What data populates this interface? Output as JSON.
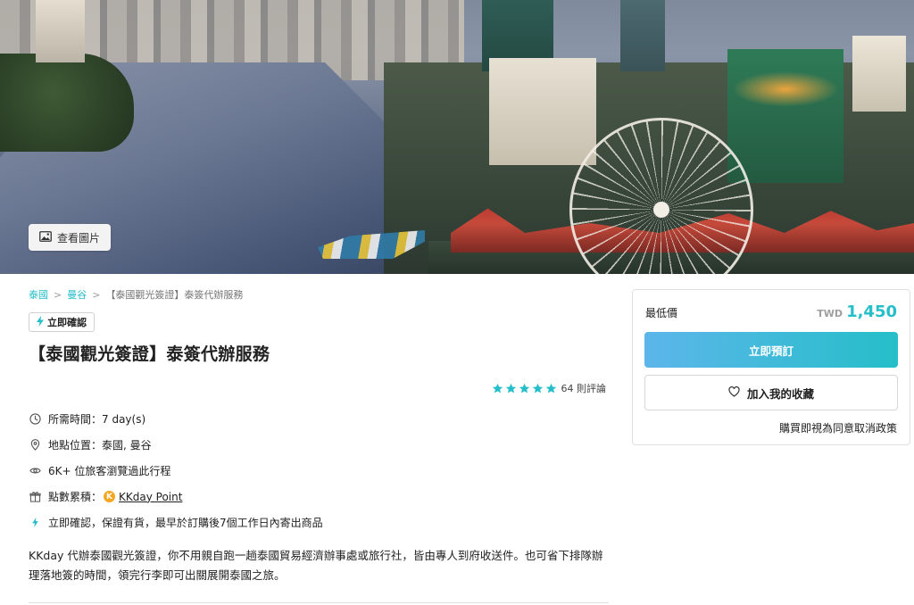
{
  "hero": {
    "view_photos_label": "查看圖片",
    "photo_icon": "image-icon"
  },
  "breadcrumb": {
    "items": [
      "泰國",
      "曼谷",
      "【泰國觀光簽證】泰簽代辦服務"
    ],
    "separator": ">"
  },
  "badge": {
    "label": "立即確認",
    "icon": "lightning-icon"
  },
  "product": {
    "title": "【泰國觀光簽證】泰簽代辦服務",
    "rating": {
      "stars": 5,
      "max_stars": 5,
      "count_label": "64 則評論"
    }
  },
  "info": {
    "duration": "所需時間：7 day(s)",
    "location": "地點位置：泰國, 曼谷",
    "views": "6K+ 位旅客瀏覽過此行程",
    "points_prefix": "點數累積：",
    "points_coin": "K",
    "points_link": "KKday Point",
    "confirmation": "立即確認，保證有貨，最早於訂購後7個工作日內寄出商品"
  },
  "description": "KKday 代辦泰國觀光簽證，你不用親自跑一趟泰國貿易經濟辦事處或旅行社，皆由專人到府收送件。也可省下排隊辦理落地簽的時間，領完行李即可出關展開泰國之旅。",
  "booking": {
    "price_label": "最低價",
    "currency": "TWD",
    "price": "1,450",
    "book_label": "立即預訂",
    "wishlist_label": "加入我的收藏",
    "terms_label": "購買即視為同意取消政策"
  },
  "colors": {
    "accent": "#26bec9",
    "gradient_start": "#5cb6ea",
    "text": "#212121"
  }
}
